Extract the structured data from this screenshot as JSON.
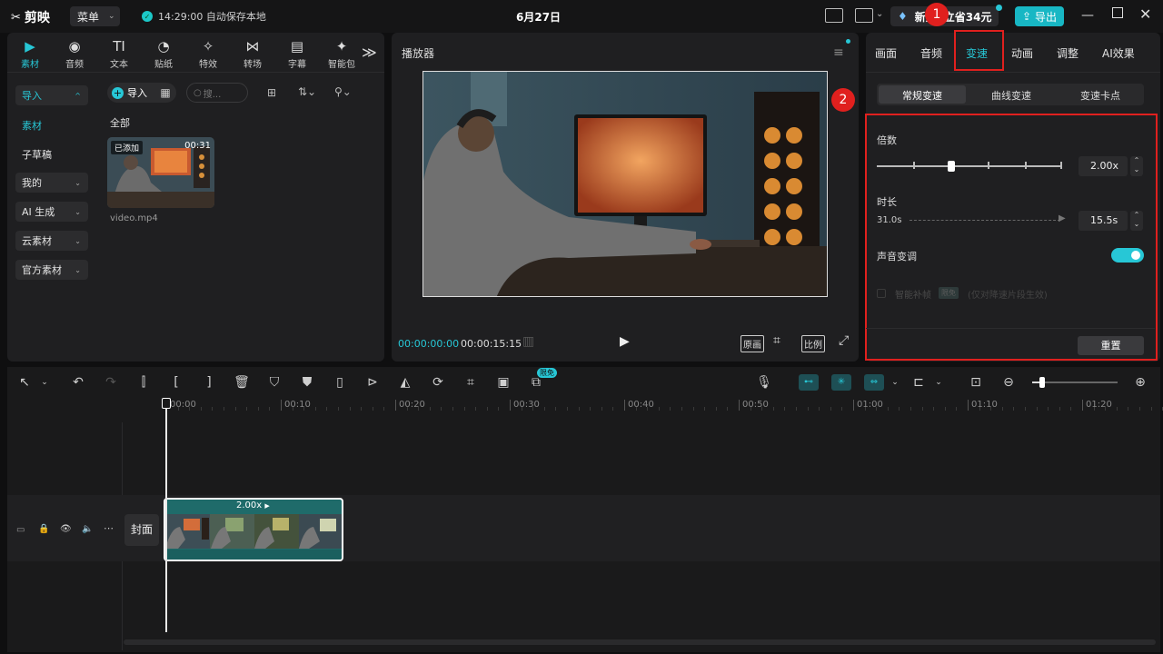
{
  "titlebar": {
    "app_name": "剪映",
    "menu_label": "菜单",
    "save_status": "14:29:00 自动保存本地",
    "date": "6月27日",
    "promo_left": "新人",
    "promo_right": "立省34元",
    "export_label": "导出",
    "annotation_1": "1",
    "annotation_2": "2"
  },
  "media_panel": {
    "tabs": [
      {
        "label": "素材",
        "icon": "media-icon"
      },
      {
        "label": "音频",
        "icon": "audio-icon"
      },
      {
        "label": "文本",
        "icon": "text-icon"
      },
      {
        "label": "贴纸",
        "icon": "sticker-icon"
      },
      {
        "label": "特效",
        "icon": "effects-icon"
      },
      {
        "label": "转场",
        "icon": "transition-icon"
      },
      {
        "label": "字幕",
        "icon": "caption-icon"
      },
      {
        "label": "智能包",
        "icon": "smart-icon"
      }
    ],
    "side_items": [
      {
        "label": "导入"
      },
      {
        "label": "素材"
      },
      {
        "label": "子草稿"
      },
      {
        "label": "我的"
      },
      {
        "label": "AI 生成"
      },
      {
        "label": "云素材"
      },
      {
        "label": "官方素材"
      }
    ],
    "import_label": "导入",
    "search_placeholder": "搜...",
    "section_label": "全部",
    "clip": {
      "badge": "已添加",
      "duration": "00:31",
      "filename": "video.mp4"
    }
  },
  "player": {
    "title": "播放器",
    "current_time": "00:00:00:00",
    "total_time": "00:00:15:15",
    "btn_original": "原画",
    "btn_ratio": "比例"
  },
  "props": {
    "tabs": [
      "画面",
      "音频",
      "变速",
      "动画",
      "调整",
      "AI效果"
    ],
    "active_tab": "变速",
    "subtabs": [
      "常规变速",
      "曲线变速",
      "变速卡点"
    ],
    "speed_label": "倍数",
    "speed_value": "2.00x",
    "speed_level": 0.4,
    "duration_label": "时长",
    "duration_from": "31.0s",
    "duration_to": "15.5s",
    "pitch_label": "声音变调",
    "smooth_label": "智能补帧",
    "smooth_badge": "限免",
    "smooth_hint": "(仅对降速片段生效)",
    "reset_label": "重置",
    "accent": "#27c7d6",
    "highlight": "#e0201e"
  },
  "toolbar": {
    "free_badge": "限免"
  },
  "timeline": {
    "ticks": [
      "00:00",
      "00:10",
      "00:20",
      "00:30",
      "00:40",
      "00:50",
      "01:00",
      "01:10",
      "01:20"
    ],
    "cover_label": "封面",
    "clip_speed": "2.00x"
  }
}
